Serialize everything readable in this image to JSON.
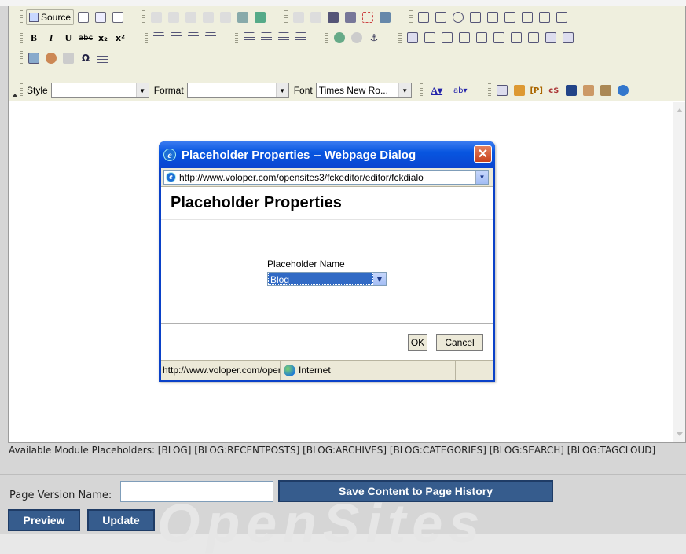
{
  "toolbar": {
    "source_label": "Source",
    "style_label": "Style",
    "style_value": "",
    "format_label": "Format",
    "format_value": "",
    "font_label": "Font",
    "font_value": "Times New Ro..."
  },
  "dialog": {
    "title": "Placeholder Properties -- Webpage Dialog",
    "url": "http://www.voloper.com/opensites3/fckeditor/editor/fckdialo",
    "heading": "Placeholder Properties",
    "field_label": "Placeholder Name",
    "field_value": "Blog",
    "ok_label": "OK",
    "cancel_label": "Cancel",
    "status_url": "http://www.voloper.com/oper",
    "status_zone": "Internet"
  },
  "page": {
    "available_placeholders": "Available Module Placeholders: [BLOG] [BLOG:RECENTPOSTS] [BLOG:ARCHIVES] [BLOG:CATEGORIES] [BLOG:SEARCH] [BLOG:TAGCLOUD]",
    "version_label": "Page Version Name:",
    "version_value": "",
    "save_label": "Save Content to Page History",
    "preview_label": "Preview",
    "update_label": "Update",
    "watermark": "OpenSites"
  },
  "colors": {
    "button_blue": "#365c8d",
    "dialog_title_blue": "#0a45d0",
    "toolbar_bg": "#efefde",
    "selection": "#316ac5"
  }
}
